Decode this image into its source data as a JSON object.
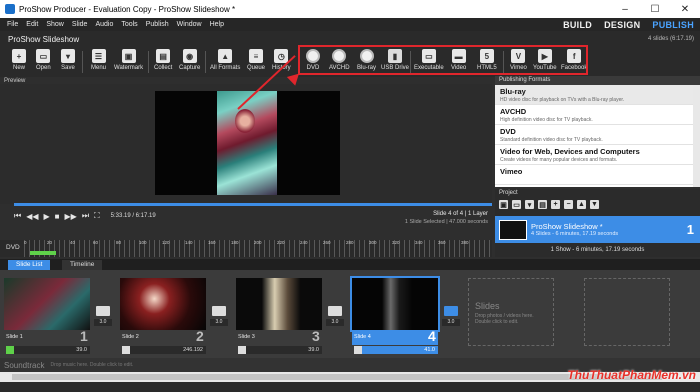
{
  "window": {
    "title": "ProShow Producer - Evaluation Copy - ProShow Slideshow *",
    "controls": [
      "–",
      "☐",
      "✕"
    ]
  },
  "menu": {
    "items": [
      "File",
      "Edit",
      "Show",
      "Slide",
      "Audio",
      "Tools",
      "Publish",
      "Window",
      "Help"
    ],
    "modes": [
      "BUILD",
      "DESIGN",
      "PUBLISH"
    ],
    "active_mode": "PUBLISH"
  },
  "project_header": {
    "name": "ProShow Slideshow",
    "info": "4 slides (6:17.19)"
  },
  "toolbar": {
    "left": [
      "New",
      "Open",
      "Save",
      "Menu",
      "Watermark",
      "Collect",
      "Capture",
      "All Formats",
      "Queue",
      "History"
    ],
    "formats": [
      "DVD",
      "AVCHD",
      "Blu-ray",
      "USB Drive",
      "Executable",
      "Video",
      "HTML5",
      "Vimeo",
      "YouTube",
      "Facebook"
    ]
  },
  "preview": {
    "label": "Preview",
    "time": "5:33.19 / 6:17.19",
    "slide_line": "Slide 4 of 4  |  1 Layer",
    "selected_line": "1 Slide Selected  |  47.000 seconds"
  },
  "publishing_formats": {
    "header": "Publishing Formats",
    "items": [
      {
        "name": "Blu-ray",
        "desc": "HD video disc for playback on TVs with a Blu-ray player."
      },
      {
        "name": "AVCHD",
        "desc": "High definition video disc for TV playback."
      },
      {
        "name": "DVD",
        "desc": "Standard definition video disc for TV playback."
      },
      {
        "name": "Video for Web, Devices and Computers",
        "desc": "Create videos for many popular devices and formats."
      },
      {
        "name": "Vimeo",
        "desc": ""
      }
    ]
  },
  "project_panel": {
    "header": "Project",
    "item_title": "ProShow Slideshow *",
    "item_sub": "4 Slides - 6 minutes, 17.19 seconds",
    "item_num": "1",
    "footer": "1 Show - 6 minutes, 17.19 seconds"
  },
  "ruler": {
    "label": "DVD",
    "ticks": [
      "0",
      "20",
      "40",
      "60",
      "80",
      "100",
      "120",
      "140",
      "160",
      "180",
      "200",
      "220",
      "240",
      "260",
      "280",
      "300",
      "320",
      "340",
      "360",
      "380"
    ]
  },
  "tabs": [
    "Slide List",
    "Timeline"
  ],
  "slides": [
    {
      "label": "Slide 1",
      "num": "1",
      "duration": "39.0",
      "transition": "3.0"
    },
    {
      "label": "Slide 2",
      "num": "2",
      "duration": "246.192",
      "transition": "3.0"
    },
    {
      "label": "Slide 3",
      "num": "3",
      "duration": "39.0",
      "transition": "3.0"
    },
    {
      "label": "Slide 4",
      "num": "4",
      "duration": "41.0",
      "transition": "3.0"
    }
  ],
  "empty_slot": {
    "title": "Slides",
    "hint1": "Drop photos / videos here.",
    "hint2": "Double click to edit."
  },
  "soundtrack": {
    "label": "Soundtrack",
    "hint": "Drop music here.   Double click to edit."
  },
  "watermark": "ThuThuatPhanMem.vn",
  "colors": {
    "accent": "#3d8de6",
    "highlight": "#e0262c",
    "publish": "#4aa3ff"
  }
}
